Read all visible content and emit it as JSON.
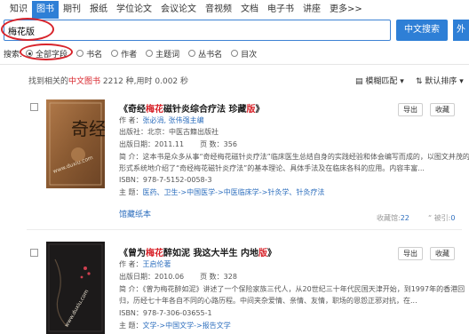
{
  "nav": {
    "tabs": [
      "知识",
      "图书",
      "期刊",
      "报纸",
      "学位论文",
      "会议论文",
      "音视频",
      "文档",
      "电子书",
      "讲座",
      "更多>>"
    ],
    "active_index": 1
  },
  "search": {
    "value": "梅花版",
    "button_label": "中文搜索",
    "button2_label": "外"
  },
  "scope": {
    "label": "搜索:",
    "options": [
      "全部字段",
      "书名",
      "作者",
      "主题词",
      "丛书名",
      "目次"
    ],
    "selected_index": 0
  },
  "summary": {
    "prefix": "找到相关的",
    "type": "中文图书",
    "count_text": "2212 种,用时 0.002 秒"
  },
  "sort": {
    "match": "模糊匹配",
    "order": "默认排序"
  },
  "results": [
    {
      "title_pre": "《奇经",
      "title_kw": "梅花",
      "title_mid": "磁针炎综合疗法 珍藏",
      "title_kw2": "版",
      "title_post": "》",
      "author_label": "作 者：",
      "author": "张必涓, 张伟强主编",
      "publisher": "出版社：北京：中医古籍出版社",
      "date_label": "出版日期：",
      "date": "2011.11",
      "pages_label": "页   数：",
      "pages": "356",
      "intro_line1": "简  介：这本书是众多从事“奇经梅花磁针炎疗法”临床医生总结自身的实践经验和体会编写而成的，以图文并茂的",
      "intro_line2": "形式系统地介绍了“奇经梅花磁针炎疗法”的基本理论、具体手法及在临床各科的应用。内容丰富...",
      "isbn": "ISBN：978-7-5152-0058-3",
      "category_label": "主  题：",
      "category": "医药、卫生->中国医学->中医临床学->针灸学、针灸疗法",
      "extra_link": "馆藏纸本",
      "import_label": "导出",
      "fav_label": "收藏",
      "fav_count_label": "收藏馆:",
      "fav_count": "22",
      "cite_label": "被引:",
      "cite_count": "0"
    },
    {
      "title_pre": "《曾为",
      "title_kw": "梅花",
      "title_mid": "醉如泥 我这大半生 内地",
      "title_kw2": "版",
      "title_post": "》",
      "author_label": "作 者：",
      "author": "王启伦著",
      "date_label": "出版日期：",
      "date": "2010.06",
      "pages_label": "页   数：",
      "pages": "328",
      "intro_line1": "简  介：《曾为梅花醉如泥》讲述了一个保险家族三代人，从20世纪三十年代民国天津开始，到1997年的香港回",
      "intro_line2": "归，历经七十年各自不同的心路历程。中间夹杂爱情、亲情、友情，职场的恩怨正邪对抗，在...",
      "isbn": "ISBN：978-7-306-03655-1",
      "category_label": "主  题：",
      "category": "文学->中国文学->报告文学",
      "import_label": "导出",
      "fav_label": "收藏"
    }
  ],
  "cover_texts": {
    "c1_title": "奇经",
    "watermark": "www.duxiu.com"
  }
}
